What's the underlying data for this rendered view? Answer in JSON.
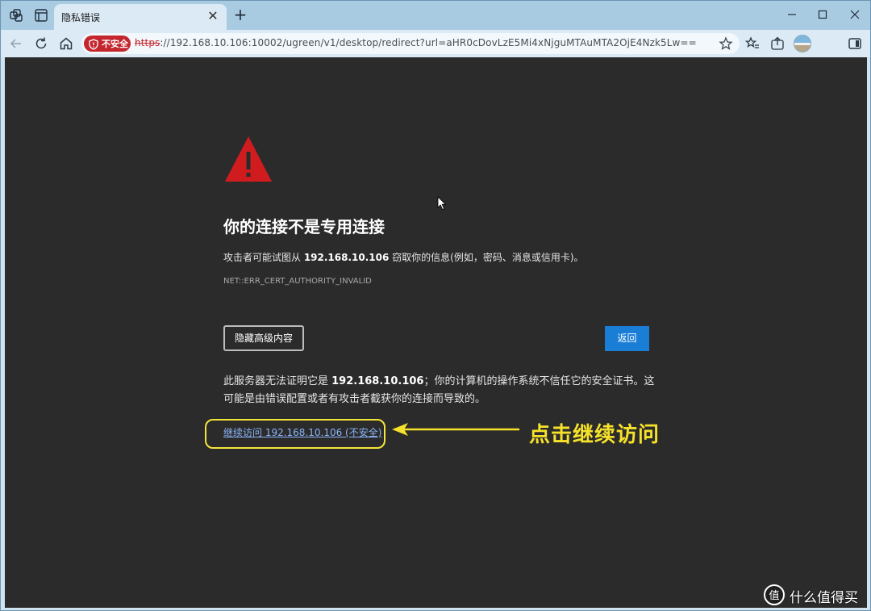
{
  "tab": {
    "title": "隐私错误",
    "close_label": "✕",
    "new_tab_label": "+"
  },
  "address_bar": {
    "security_label": "不安全",
    "url_scheme": "https",
    "url_rest": "://192.168.10.106:10002/ugreen/v1/desktop/redirect?url=aHR0cDovLzE5Mi4xNjguMTAuMTA2OjE4Nzk5Lw=="
  },
  "page": {
    "heading": "你的连接不是专用连接",
    "desc_prefix": "攻击者可能试图从 ",
    "desc_host": "192.168.10.106",
    "desc_suffix": " 窃取你的信息(例如，密码、消息或信用卡)。",
    "error_code": "NET::ERR_CERT_AUTHORITY_INVALID",
    "advanced_button": "隐藏高级内容",
    "back_button": "返回",
    "detail_prefix": "此服务器无法证明它是 ",
    "detail_host": "192.168.10.106",
    "detail_suffix": "；你的计算机的操作系统不信任它的安全证书。这可能是由错误配置或者有攻击者截获你的连接而导致的。",
    "proceed_link": "继续访问 192.168.10.106 (不安全)"
  },
  "annotation": {
    "text": "点击继续访问",
    "color": "#f7e22b"
  },
  "watermark": {
    "text": "什么值得买",
    "logo_glyph": "值"
  },
  "colors": {
    "page_bg": "#2b2b2b",
    "danger": "#c4262e",
    "primary": "#1b7ed6",
    "link": "#8ab4f8"
  }
}
